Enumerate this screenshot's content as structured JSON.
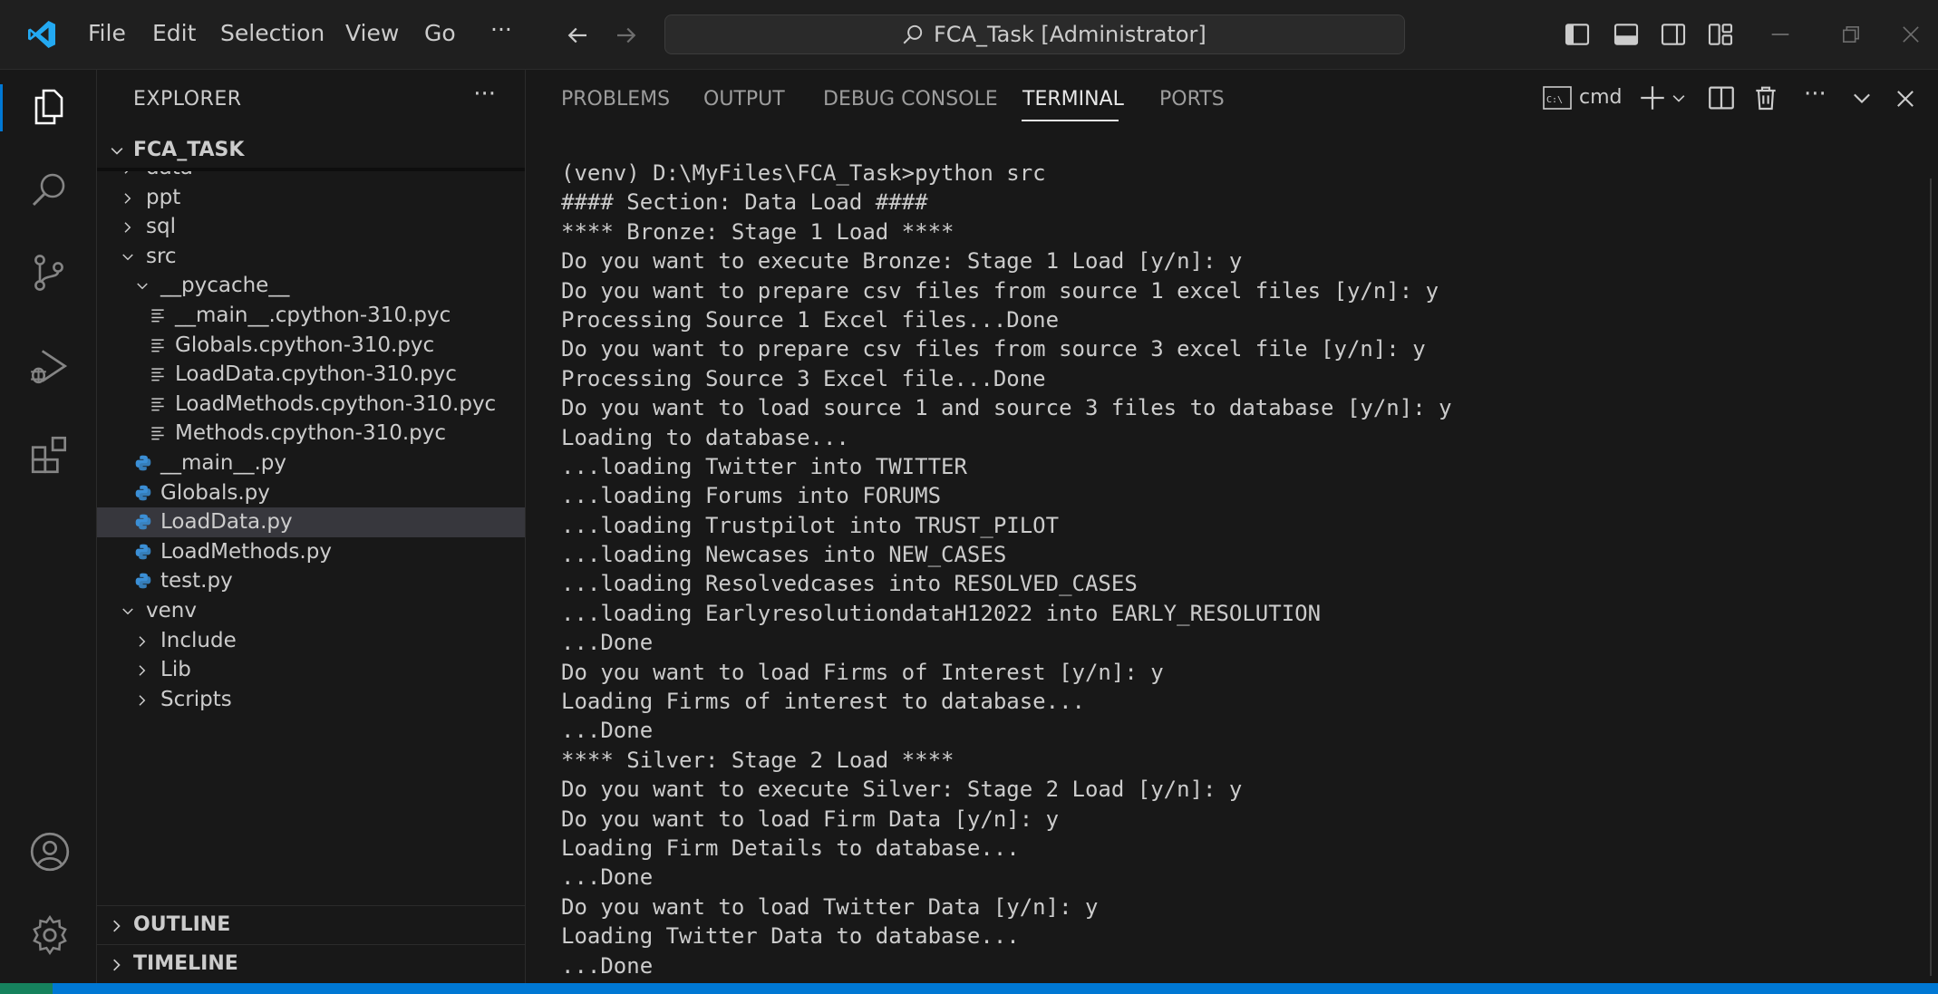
{
  "titlebar": {
    "menus": [
      "File",
      "Edit",
      "Selection",
      "View",
      "Go",
      "···"
    ],
    "search_text": "FCA_Task [Administrator]"
  },
  "sidebar": {
    "title": "EXPLORER",
    "more": "···",
    "project": "FCA_TASK",
    "items": [
      {
        "label": "data",
        "type": "folder",
        "expanded": false
      },
      {
        "label": "ppt",
        "type": "folder",
        "expanded": false
      },
      {
        "label": "sql",
        "type": "folder",
        "expanded": false
      },
      {
        "label": "src",
        "type": "folder",
        "expanded": true
      },
      {
        "label": "__pycache__",
        "type": "folder",
        "expanded": true
      },
      {
        "label": "__main__.cpython-310.pyc",
        "type": "pyc"
      },
      {
        "label": "Globals.cpython-310.pyc",
        "type": "pyc"
      },
      {
        "label": "LoadData.cpython-310.pyc",
        "type": "pyc"
      },
      {
        "label": "LoadMethods.cpython-310.pyc",
        "type": "pyc"
      },
      {
        "label": "Methods.cpython-310.pyc",
        "type": "pyc"
      },
      {
        "label": "__main__.py",
        "type": "py"
      },
      {
        "label": "Globals.py",
        "type": "py"
      },
      {
        "label": "LoadData.py",
        "type": "py",
        "selected": true
      },
      {
        "label": "LoadMethods.py",
        "type": "py"
      },
      {
        "label": "test.py",
        "type": "py"
      },
      {
        "label": "venv",
        "type": "folder",
        "expanded": true
      },
      {
        "label": "Include",
        "type": "folder",
        "expanded": false
      },
      {
        "label": "Lib",
        "type": "folder",
        "expanded": false
      },
      {
        "label": "Scripts",
        "type": "folder",
        "expanded": false
      }
    ],
    "outline": "OUTLINE",
    "timeline": "TIMELINE"
  },
  "panel": {
    "tabs": [
      "PROBLEMS",
      "OUTPUT",
      "DEBUG CONSOLE",
      "TERMINAL",
      "PORTS"
    ],
    "active_tab": "TERMINAL",
    "shell_label": "cmd"
  },
  "terminal": {
    "lines": [
      "(venv) D:\\MyFiles\\FCA_Task>python src",
      "#### Section: Data Load ####",
      "**** Bronze: Stage 1 Load ****",
      "Do you want to execute Bronze: Stage 1 Load [y/n]: y",
      "Do you want to prepare csv files from source 1 excel files [y/n]: y",
      "Processing Source 1 Excel files...Done",
      "Do you want to prepare csv files from source 3 excel file [y/n]: y",
      "Processing Source 3 Excel file...Done",
      "Do you want to load source 1 and source 3 files to database [y/n]: y",
      "Loading to database...",
      "...loading Twitter into TWITTER",
      "...loading Forums into FORUMS",
      "...loading Trustpilot into TRUST_PILOT",
      "...loading Newcases into NEW_CASES",
      "...loading Resolvedcases into RESOLVED_CASES",
      "...loading EarlyresolutiondataH12022 into EARLY_RESOLUTION",
      "...Done",
      "Do you want to load Firms of Interest [y/n]: y",
      "Loading Firms of interest to database...",
      "...Done",
      "**** Silver: Stage 2 Load ****",
      "Do you want to execute Silver: Stage 2 Load [y/n]: y",
      "Do you want to load Firm Data [y/n]: y",
      "Loading Firm Details to database...",
      "...Done",
      "Do you want to load Twitter Data [y/n]: y",
      "Loading Twitter Data to database...",
      "...Done"
    ]
  },
  "colors": {
    "background": "#181818",
    "text": "#cccccc",
    "accent": "#0078d4",
    "vscode_blue": "#23a9f2",
    "python_blue": "#3b8fd6",
    "python_yellow": "#f0cd46",
    "selected_row": "#37373d"
  }
}
